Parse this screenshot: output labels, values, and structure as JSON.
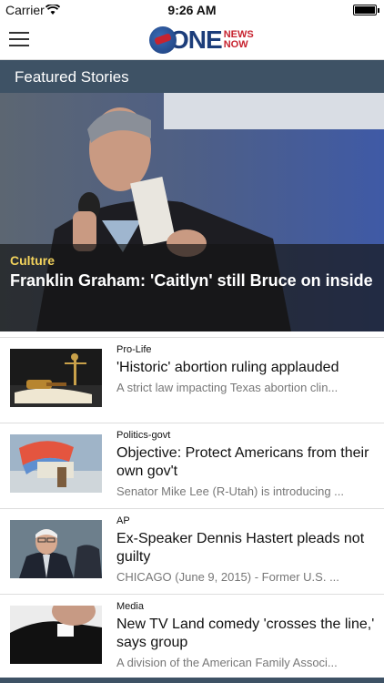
{
  "status_bar": {
    "carrier": "Carrier",
    "time": "9:26 AM"
  },
  "nav": {
    "logo_one": "ONE",
    "logo_news": "NEWS",
    "logo_now": "NOW"
  },
  "section": {
    "title": "Featured Stories"
  },
  "featured": {
    "category": "Culture",
    "headline": "Franklin Graham: 'Caitlyn' still Bruce on inside"
  },
  "stories": [
    {
      "category": "Pro-Life",
      "headline": "'Historic' abortion ruling applauded",
      "summary": "A strict law impacting Texas abortion clin..."
    },
    {
      "category": "Politics-govt",
      "headline": "Objective: Protect Americans from their own gov't",
      "summary": "Senator Mike Lee (R-Utah) is introducing ..."
    },
    {
      "category": "AP",
      "headline": "Ex-Speaker Dennis Hastert pleads not guilty",
      "summary": "CHICAGO (June 9, 2015) - Former U.S. ..."
    },
    {
      "category": "Media",
      "headline": "New TV Land comedy 'crosses the line,' says group",
      "summary": "A division of the American Family Associ..."
    }
  ],
  "colors": {
    "section_header": "#3e5265",
    "category_highlight": "#f2d25c",
    "brand_blue": "#1c3d7a",
    "brand_red": "#c7232f"
  }
}
